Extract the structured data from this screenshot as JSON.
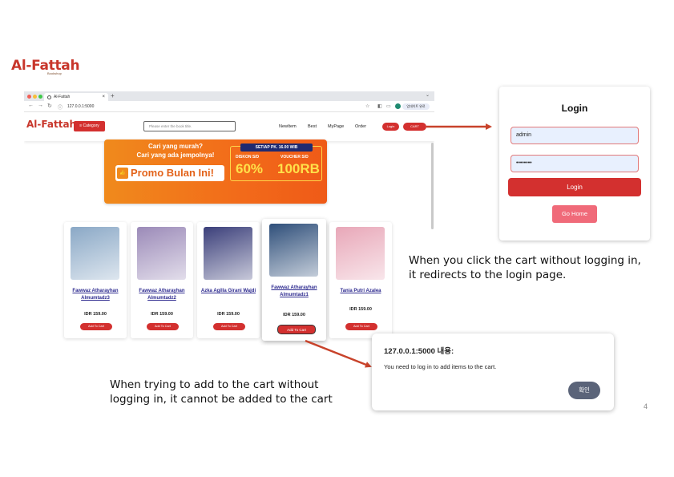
{
  "slide": {
    "logo": "Al-Fattah",
    "logo_tagline": "Bookshop",
    "page_number": "4"
  },
  "browser": {
    "tab_title": "Al-Fattah",
    "tab_close": "×",
    "new_tab": "+",
    "url": "127.0.0.1:5000",
    "profile_label": "업데이트 완료"
  },
  "site": {
    "logo": "Al-Fattah",
    "category_label": "≡ Category",
    "search_placeholder": "Please enter the book title.",
    "nav": [
      "NewItem",
      "Best",
      "MyPage",
      "Order"
    ],
    "login_label": "Login",
    "cart_label": "CART"
  },
  "banner": {
    "line1": "Cari yang murah?",
    "line2": "Cari yang ada jempolnya!",
    "promo": "Promo Bulan Ini!",
    "setiap": "SETIAP PK. 16.00 WIB",
    "diskon_label": "DISKON S/D",
    "diskon_value": "60%",
    "voucher_label": "VOUCHER S/D",
    "voucher_value": "100RB"
  },
  "products": [
    {
      "title": "Fawwaz Atharayhan Almumtadz3",
      "price": "IDR 159.00",
      "button": "Add To Cart",
      "cover_color": "#8aa8c6"
    },
    {
      "title": "Fawwaz Atharayhan Almumtadz2",
      "price": "IDR 159.00",
      "button": "Add To Cart",
      "cover_color": "#9b8ab8"
    },
    {
      "title": "Azka Agilla Girani Wajdi",
      "price": "IDR 159.00",
      "button": "Add To Cart",
      "cover_color": "#3b3f7a"
    },
    {
      "title": "Fawwaz Atharayhan Almumtadz1",
      "price": "IDR 159.00",
      "button": "Add To Cart",
      "cover_color": "#2f4f7a"
    },
    {
      "title": "Tania Putri Azalea",
      "price": "IDR 159.00",
      "button": "Add To Cart",
      "cover_color": "#e8a7b8"
    }
  ],
  "login_panel": {
    "title": "Login",
    "username_value": "admin",
    "password_value": "••••••••",
    "login_button": "Login",
    "home_button": "Go Home"
  },
  "captions": {
    "redirect_line1": "When you click the cart without logging in,",
    "redirect_line2": "it redirects to the login page.",
    "add_line1": "When trying to add to the cart without",
    "add_line2": "logging in, it cannot be added to the cart"
  },
  "dialog": {
    "title": "127.0.0.1:5000 내용:",
    "message": "You need to log in to add items to the cart.",
    "ok_button": "확인"
  },
  "colors": {
    "brand_red": "#d3302f",
    "arrow_red": "#c8432b",
    "banner_orange": "#f26b1a"
  }
}
